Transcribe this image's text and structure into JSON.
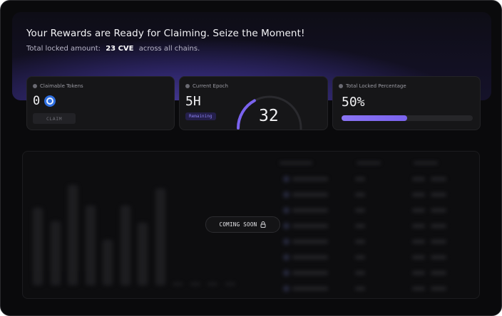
{
  "hero": {
    "title": "Your Rewards are Ready for Claiming. Seize the Moment!",
    "sub_prefix": "Total locked amount:",
    "amount": "23 CVE",
    "sub_suffix": "across all chains."
  },
  "cards": {
    "claimable": {
      "label": "Claimable Tokens",
      "value": "0",
      "icon": "cve-token-icon",
      "button": "CLAIM"
    },
    "epoch": {
      "label": "Current Epoch",
      "value": "5H",
      "badge": "Remaining",
      "number": "32",
      "ring_fraction": 0.17
    },
    "locked": {
      "label": "Total Locked Percentage",
      "value": "50%",
      "progress": 0.5
    }
  },
  "table": {
    "overlay": "COMING SOON",
    "overlay_icon": "lock-icon",
    "bar_levels": [
      0.68,
      0.56,
      0.88,
      0.7,
      0.4,
      0.7,
      0.55,
      0.85,
      0.02,
      0.02,
      0.02,
      0.02
    ],
    "rows": 8
  },
  "colors": {
    "accent": "#7a63ee",
    "token_blue": "#2f6fe0",
    "background": "#0a0a0c"
  }
}
